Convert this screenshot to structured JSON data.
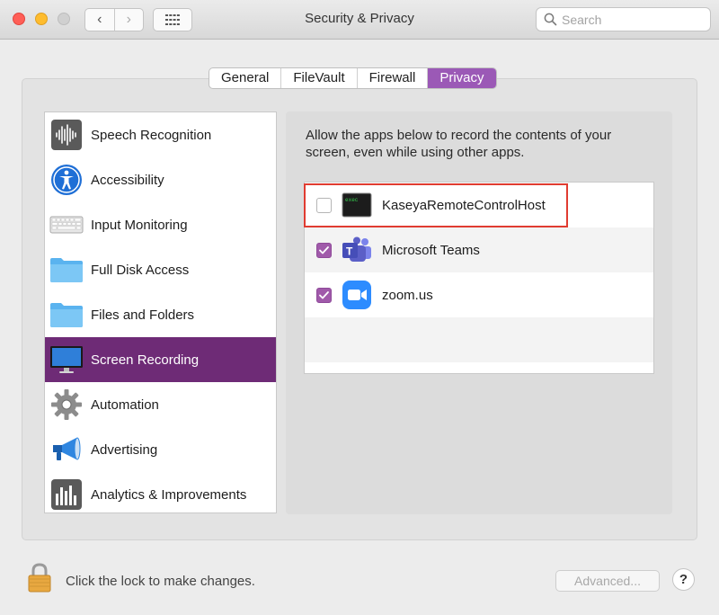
{
  "window": {
    "title": "Security & Privacy"
  },
  "toolbar": {
    "back_glyph": "‹",
    "forward_glyph": "›",
    "grid_icon": "grid-icon"
  },
  "search": {
    "placeholder": "Search",
    "value": ""
  },
  "tabs": [
    {
      "label": "General",
      "active": false
    },
    {
      "label": "FileVault",
      "active": false
    },
    {
      "label": "Firewall",
      "active": false
    },
    {
      "label": "Privacy",
      "active": true
    }
  ],
  "sidebar": {
    "items": [
      {
        "label": "Speech Recognition",
        "icon": "waveform-icon"
      },
      {
        "label": "Accessibility",
        "icon": "accessibility-icon"
      },
      {
        "label": "Input Monitoring",
        "icon": "keyboard-icon"
      },
      {
        "label": "Full Disk Access",
        "icon": "folder-icon"
      },
      {
        "label": "Files and Folders",
        "icon": "folder-icon"
      },
      {
        "label": "Screen Recording",
        "icon": "monitor-icon",
        "selected": true
      },
      {
        "label": "Automation",
        "icon": "gear-icon"
      },
      {
        "label": "Advertising",
        "icon": "megaphone-icon"
      },
      {
        "label": "Analytics & Improvements",
        "icon": "bar-chart-icon"
      }
    ]
  },
  "main": {
    "description": "Allow the apps below to record the contents of your screen, even while using other apps.",
    "apps": [
      {
        "name": "KaseyaRemoteControlHost",
        "checked": false,
        "icon": "terminal-icon",
        "icon_text": "exec"
      },
      {
        "name": "Microsoft Teams",
        "checked": true,
        "icon": "teams-icon",
        "icon_text": "T"
      },
      {
        "name": "zoom.us",
        "checked": true,
        "icon": "zoom-icon"
      }
    ]
  },
  "footer": {
    "lock_text": "Click the lock to make changes.",
    "advanced_label": "Advanced...",
    "help_label": "?"
  },
  "colors": {
    "accent": "#9b59b6",
    "selected_row": "#6e2b76",
    "checkbox": "#a05aaa",
    "highlight_box": "#e03c31"
  }
}
